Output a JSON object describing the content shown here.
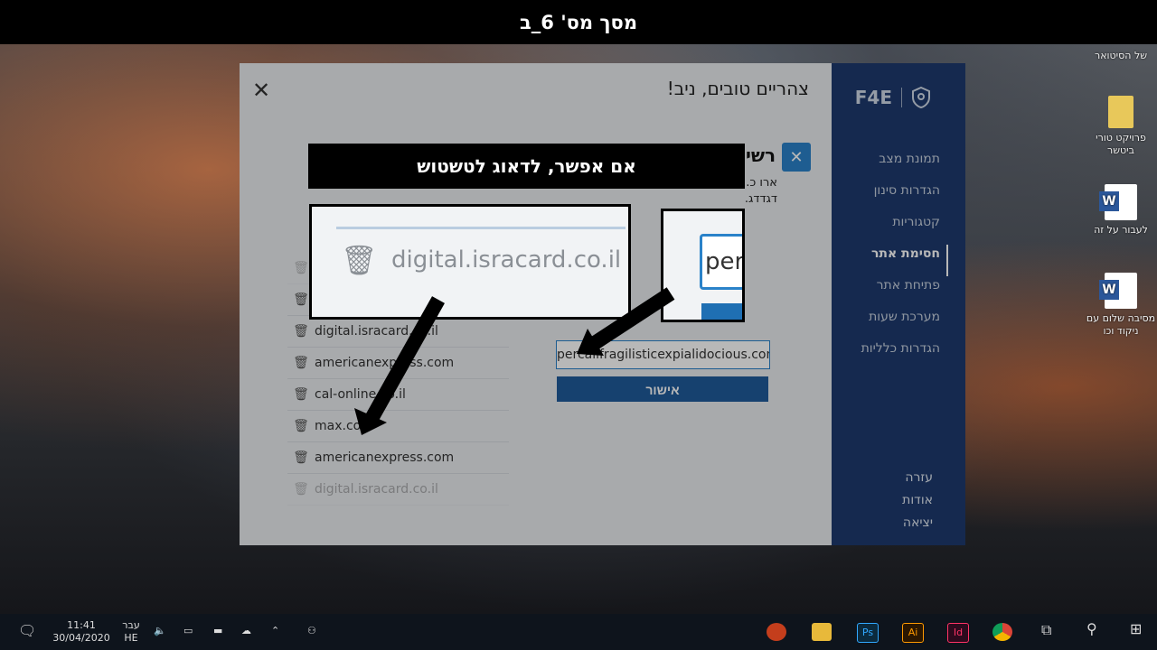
{
  "header": {
    "title": "מסך מס' 6_ב"
  },
  "desktop": {
    "icons": [
      {
        "label": "של הסיטואר"
      },
      {
        "label": "פרויקט טורי ביטשר"
      },
      {
        "label": "לעבור על זה"
      },
      {
        "label": "מסיבה שלום עם ניקוד וכו"
      }
    ]
  },
  "app": {
    "brand": "F4E",
    "greeting": "צהריים טובים, ניב!",
    "section_title": "רשי",
    "description": "ארו כ... בקודה, קבצים לגרפיקו. קיצו. נה חד. פוגרפיקוד השר לגרפיקה בעצמהר אתם אחון דגדדג.",
    "side_text": "הוספ פשכ קבצ ללה את ה",
    "nav": [
      {
        "label": "תמונת מצב"
      },
      {
        "label": "הגדרות סינון"
      },
      {
        "label": "קטגוריות"
      },
      {
        "label": "חסימת אתר",
        "active": true
      },
      {
        "label": "פתיחת אתר"
      },
      {
        "label": "מערכת שעות"
      },
      {
        "label": "הגדרות כלליות"
      }
    ],
    "bottom_nav": [
      {
        "label": "עזרה"
      },
      {
        "label": "אודות"
      },
      {
        "label": "יציאה"
      }
    ],
    "blocked_sites": [
      {
        "domain": ""
      },
      {
        "domain": ""
      },
      {
        "domain": "digital.isracard.co.il"
      },
      {
        "domain": "americanexpress.com"
      },
      {
        "domain": "cal-online.co.il"
      },
      {
        "domain": "max.co.il"
      },
      {
        "domain": "americanexpress.com"
      },
      {
        "domain": "digital.isracard.co.il"
      }
    ],
    "url_input_value": "percalifragilisticexpialidocious.com",
    "ok_button": "אישור"
  },
  "overlay": {
    "tip": "אם אפשר, לדאוג לטשטוש",
    "zoom_text": "digital.isracard.co.il",
    "zoom_input_text": "per"
  },
  "taskbar": {
    "time": "11:41",
    "date": "30/04/2020",
    "lang_top": "עבר",
    "lang": "HE",
    "apps": [
      "powerpoint",
      "explorer",
      "photoshop",
      "illustrator",
      "indesign",
      "chrome",
      "task-view",
      "search",
      "start"
    ]
  }
}
